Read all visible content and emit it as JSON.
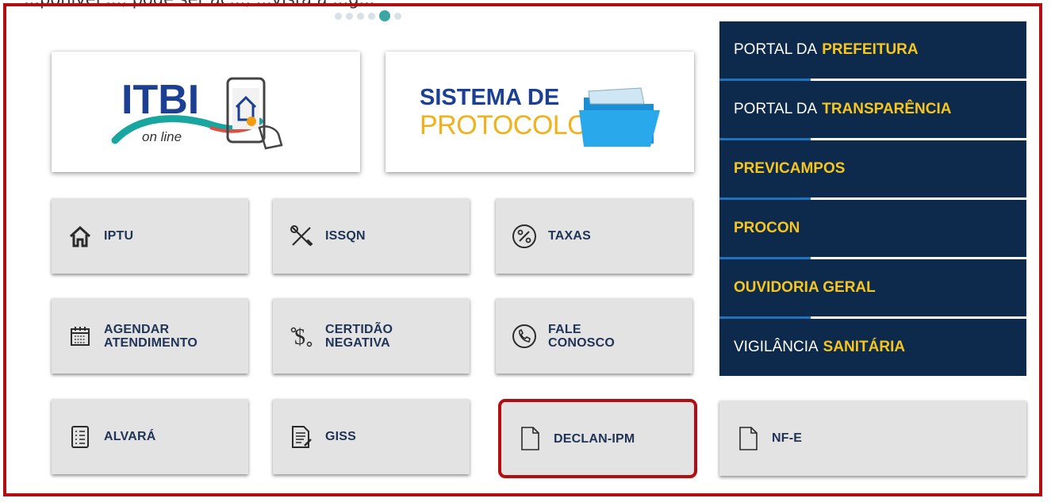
{
  "top_caption": "...ponível ..., pode ser ac..., ...vista a ...g...",
  "carousel": {
    "slide_count": 6,
    "active_index": 4
  },
  "itbi": {
    "title": "ITBI",
    "subtitle": "on line"
  },
  "protocolo": {
    "line1": "SISTEMA DE",
    "line2": "PROTOCOLO"
  },
  "tiles": {
    "iptu": "IPTU",
    "issqn": "ISSQN",
    "taxas": "TAXAS",
    "agendar": [
      "AGENDAR",
      "ATENDIMENTO"
    ],
    "certidao": [
      "CERTIDÃO",
      "NEGATIVA"
    ],
    "fale": [
      "FALE",
      "CONOSCO"
    ],
    "alvara": "ALVARÁ",
    "giss": "GISS",
    "declan": "DECLAN-IPM",
    "nfe": "NF-E"
  },
  "side_links": [
    {
      "prefix": "PORTAL DA",
      "highlight": "PREFEITURA"
    },
    {
      "prefix": "PORTAL DA",
      "highlight": "TRANSPARÊNCIA"
    },
    {
      "prefix": "",
      "highlight": "PREVICAMPOS"
    },
    {
      "prefix": "",
      "highlight": "PROCON"
    },
    {
      "prefix": "",
      "highlight": "OUVIDORIA GERAL"
    },
    {
      "prefix": "VIGILÂNCIA",
      "highlight": "SANITÁRIA"
    }
  ],
  "colors": {
    "navy": "#0d2a4c",
    "gold": "#f6c61e",
    "tile_text": "#1f3356",
    "highlight_red": "#b00e12"
  }
}
